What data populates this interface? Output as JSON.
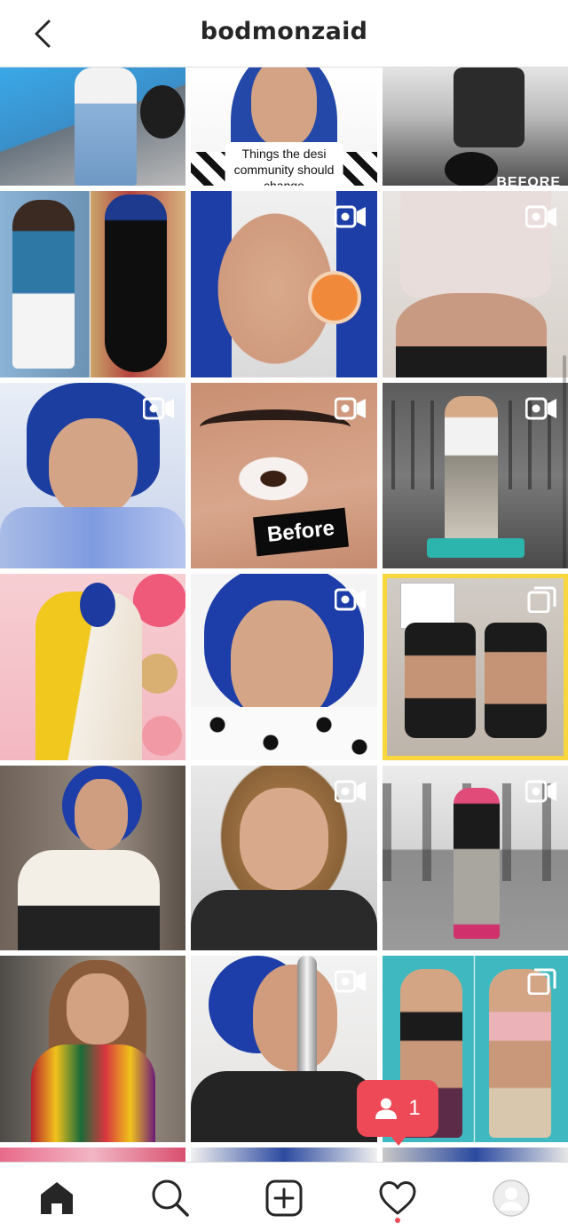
{
  "header": {
    "username": "bodmonzaid",
    "back_icon": "chevron-left-icon"
  },
  "grid": {
    "posts": [
      {
        "row": 0,
        "col": 0,
        "type": "photo",
        "bg": "#3d9fd8"
      },
      {
        "row": 0,
        "col": 1,
        "type": "video",
        "bg": "#c7a99a",
        "caption_lines": [
          "Things the desi",
          "community should",
          "change"
        ]
      },
      {
        "row": 0,
        "col": 2,
        "type": "photo",
        "bg": "#8c8c8c",
        "corner_text": "BEFORE"
      },
      {
        "row": 1,
        "col": 0,
        "type": "photo",
        "bg": "#7d9fc0"
      },
      {
        "row": 1,
        "col": 1,
        "type": "video",
        "bg": "#d9b6a0"
      },
      {
        "row": 1,
        "col": 2,
        "type": "video",
        "bg": "#cbb29f"
      },
      {
        "row": 2,
        "col": 0,
        "type": "video",
        "bg": "#8ea8d8"
      },
      {
        "row": 2,
        "col": 1,
        "type": "video",
        "bg": "#d7a389",
        "overlay_text": "Before"
      },
      {
        "row": 2,
        "col": 2,
        "type": "video",
        "bg": "#6f6f6f"
      },
      {
        "row": 3,
        "col": 0,
        "type": "photo",
        "bg": "#f0b8c2"
      },
      {
        "row": 3,
        "col": 1,
        "type": "video",
        "bg": "#eeeeee"
      },
      {
        "row": 3,
        "col": 2,
        "type": "carousel",
        "bg": "#d8d2cc"
      },
      {
        "row": 4,
        "col": 0,
        "type": "photo",
        "bg": "#8b8178"
      },
      {
        "row": 4,
        "col": 1,
        "type": "video",
        "bg": "#5a4a3e"
      },
      {
        "row": 4,
        "col": 2,
        "type": "video",
        "bg": "#7a7a7a"
      },
      {
        "row": 5,
        "col": 0,
        "type": "photo",
        "bg": "#9a8a7c"
      },
      {
        "row": 5,
        "col": 1,
        "type": "video",
        "bg": "#e7e5e3"
      },
      {
        "row": 5,
        "col": 2,
        "type": "carousel",
        "bg": "#3fb7bd"
      }
    ]
  },
  "notification": {
    "icon": "person-icon",
    "count": "1"
  },
  "nav": {
    "items": [
      {
        "name": "home",
        "icon": "home-icon",
        "active": true
      },
      {
        "name": "search",
        "icon": "search-icon"
      },
      {
        "name": "new-post",
        "icon": "plus-square-icon"
      },
      {
        "name": "activity",
        "icon": "heart-icon"
      },
      {
        "name": "profile",
        "icon": "avatar-icon"
      }
    ]
  },
  "colors": {
    "accent": "#ed4956",
    "text": "#262626",
    "divider": "#dbdbdb",
    "carousel_highlight": "#f8d73e"
  }
}
